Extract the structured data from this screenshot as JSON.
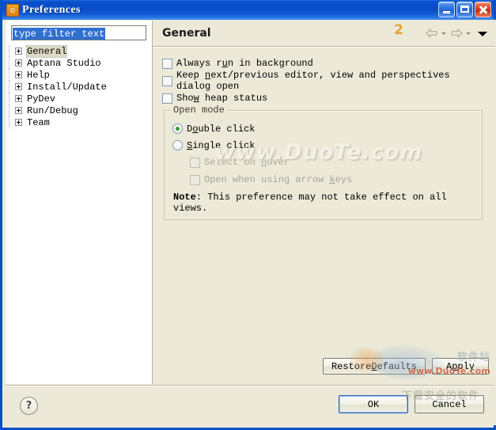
{
  "window": {
    "title": "Preferences",
    "icon": "gear-icon",
    "controls": {
      "minimize": "minimize-icon",
      "maximize": "maximize-icon",
      "close": "close-icon"
    }
  },
  "colors": {
    "titlebar_blue": "#0A4CC6",
    "dialog_bg": "#ECE9D8",
    "tree_bg": "#FFFFFF",
    "selection_blue": "#2F6FD0",
    "radio_dot_green": "#2F9E2F",
    "close_red": "#C23317"
  },
  "sidebar": {
    "filter": {
      "value": "type filter text",
      "placeholder": "type filter text",
      "selected": true
    },
    "items": [
      {
        "label": "General",
        "expandable": true,
        "selected": true
      },
      {
        "label": "Aptana Studio",
        "expandable": true,
        "selected": false
      },
      {
        "label": "Help",
        "expandable": true,
        "selected": false
      },
      {
        "label": "Install/Update",
        "expandable": true,
        "selected": false
      },
      {
        "label": "PyDev",
        "expandable": true,
        "selected": false
      },
      {
        "label": "Run/Debug",
        "expandable": true,
        "selected": false
      },
      {
        "label": "Team",
        "expandable": true,
        "selected": false
      }
    ]
  },
  "main": {
    "title": "General",
    "nav": {
      "back": "back-arrow-icon",
      "back_caret": "chevron-down-icon",
      "forward": "forward-arrow-icon",
      "forward_caret": "chevron-down-icon",
      "menu_caret": "chevron-down-icon"
    },
    "checkboxes": [
      {
        "pre": "Always r",
        "mnemonic": "u",
        "post": "n in background",
        "checked": false,
        "enabled": true
      },
      {
        "pre": "Keep ",
        "mnemonic": "n",
        "post": "ext/previous editor, view and perspectives dialog open",
        "checked": false,
        "enabled": true
      },
      {
        "pre": "Sho",
        "mnemonic": "w",
        "post": " heap status",
        "checked": false,
        "enabled": true
      }
    ],
    "open_mode": {
      "legend": "Open mode",
      "radios": [
        {
          "pre": "D",
          "mnemonic": "o",
          "post": "uble click",
          "checked": true
        },
        {
          "pre": "",
          "mnemonic": "S",
          "post": "ingle click",
          "checked": false
        }
      ],
      "sub_checkboxes": [
        {
          "pre": "Select on ",
          "mnemonic": "h",
          "post": "over",
          "checked": false,
          "enabled": false
        },
        {
          "pre": "Open when using arrow ",
          "mnemonic": "k",
          "post": "eys",
          "checked": false,
          "enabled": false
        }
      ],
      "note_label": "Note",
      "note_text": ": This preference may not take effect on all views."
    },
    "buttons": {
      "restore_defaults_pre": "Restore ",
      "restore_defaults_mnemonic": "D",
      "restore_defaults_post": "efaults",
      "apply_pre": "A",
      "apply_mnemonic": "p",
      "apply_post": "ply"
    }
  },
  "footer": {
    "help": "?",
    "ok": "OK",
    "cancel": "Cancel"
  },
  "watermarks": {
    "center": "www.DuoTe.com",
    "bottom_right": "www.DuoTe.com",
    "logo_number": "2",
    "cn_top": "软件站",
    "cn_bottom": "下载安全的软件"
  }
}
